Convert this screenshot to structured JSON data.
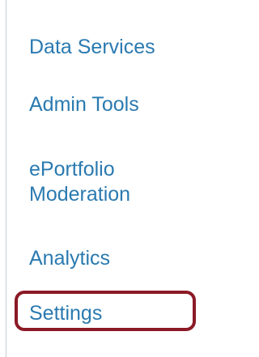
{
  "nav": {
    "items": [
      {
        "label": "Data Services"
      },
      {
        "label": "Admin Tools"
      },
      {
        "label_line1": "ePortfolio",
        "label_line2": "Moderation"
      },
      {
        "label": "Analytics"
      },
      {
        "label": "Settings",
        "highlighted": true
      }
    ]
  },
  "colors": {
    "link": "#2a7ab0",
    "highlight_border": "#8b1a26",
    "divider": "#c7cdd1"
  }
}
